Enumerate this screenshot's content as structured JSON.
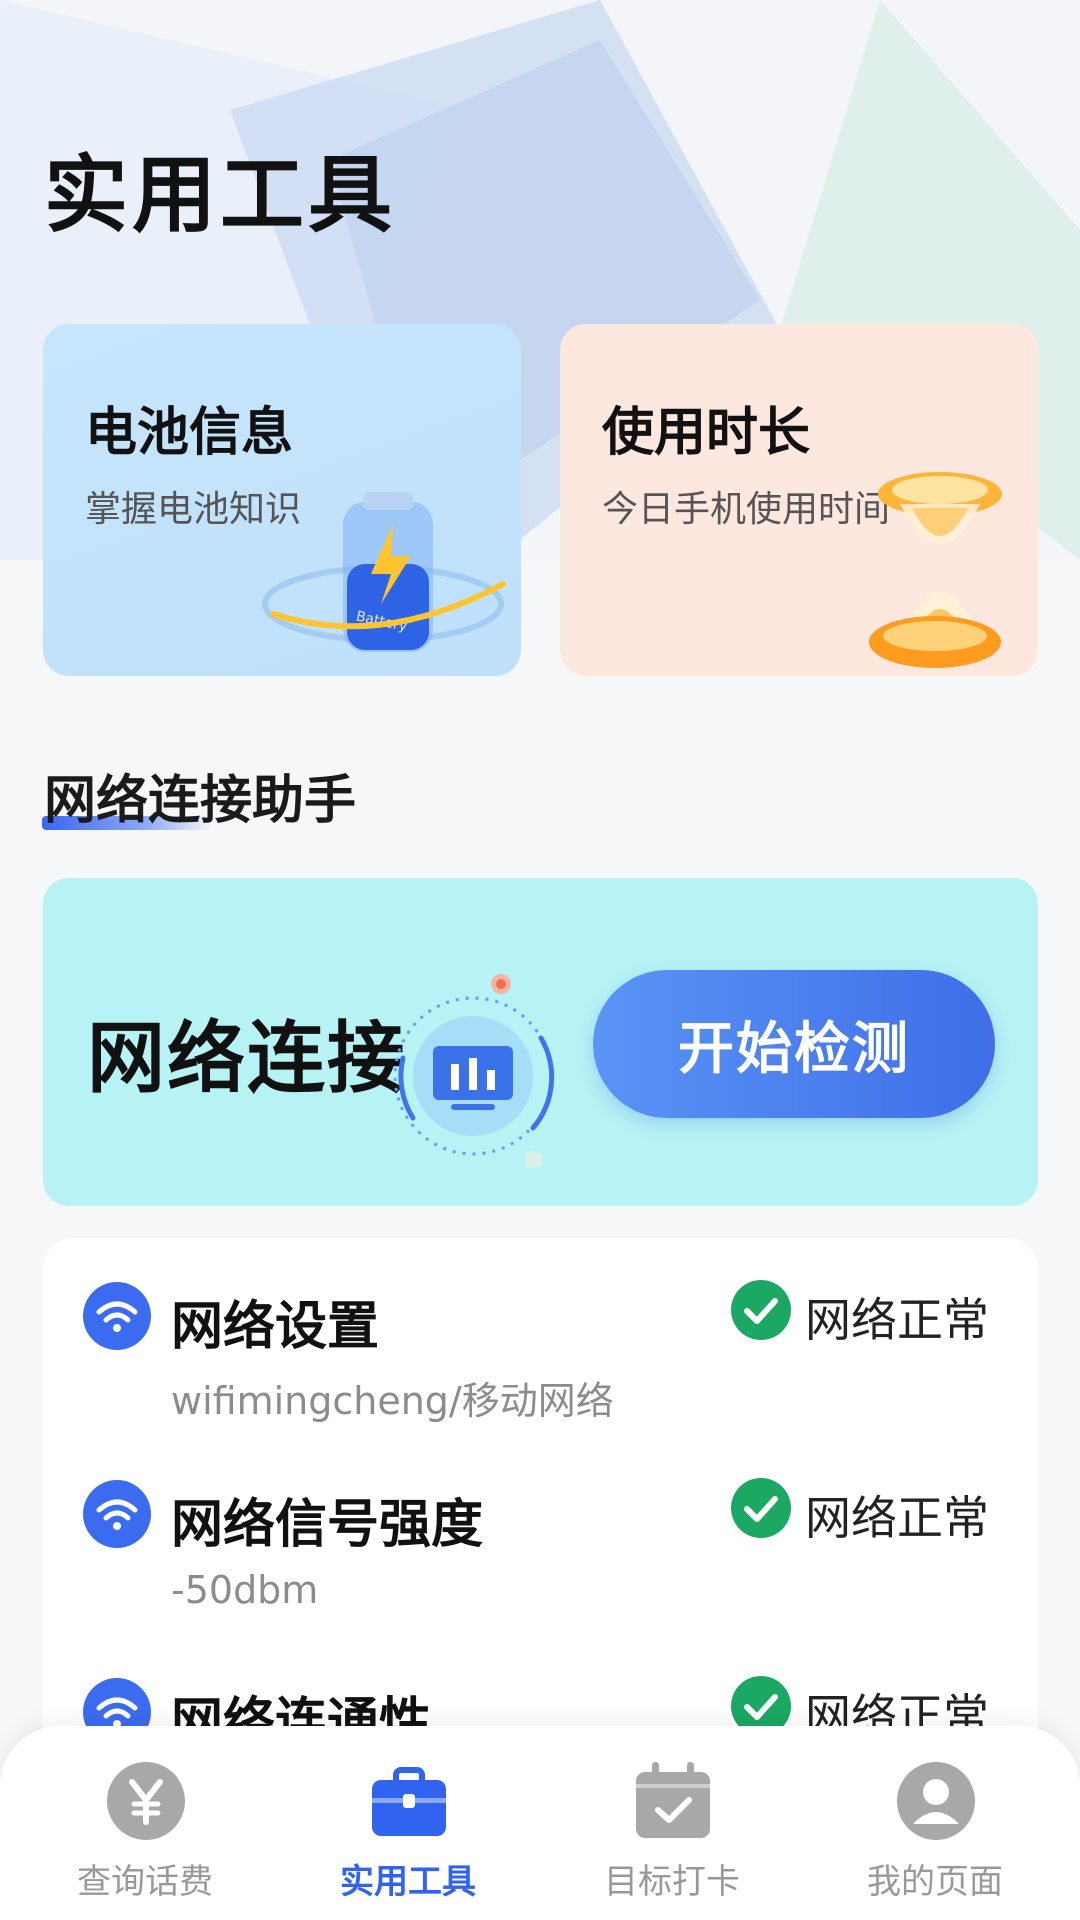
{
  "page": {
    "title": "实用工具"
  },
  "cards": {
    "battery": {
      "title": "电池信息",
      "subtitle": "掌握电池知识",
      "illus_text": "Battery"
    },
    "usage": {
      "title": "使用时长",
      "subtitle": "今日手机使用时间"
    }
  },
  "section": {
    "title": "网络连接助手"
  },
  "network_banner": {
    "title": "网络连接",
    "button_label": "开始检测"
  },
  "status_rows": [
    {
      "title": "网络设置",
      "subtitle": "wifimingcheng/移动网络",
      "status": "网络正常",
      "icon": "wifi-icon",
      "status_icon": "check-circle-icon"
    },
    {
      "title": "网络信号强度",
      "subtitle": "-50dbm",
      "status": "网络正常",
      "icon": "wifi-icon",
      "status_icon": "check-circle-icon"
    },
    {
      "title": "网络连通性",
      "subtitle": "",
      "status": "网络正常",
      "icon": "wifi-icon",
      "status_icon": "check-circle-icon"
    }
  ],
  "tabbar": {
    "items": [
      {
        "label": "查询话费",
        "icon": "yuan-icon",
        "active": false
      },
      {
        "label": "实用工具",
        "icon": "toolbox-icon",
        "active": true
      },
      {
        "label": "目标打卡",
        "icon": "calendar-check-icon",
        "active": false
      },
      {
        "label": "我的页面",
        "icon": "user-icon",
        "active": false
      }
    ]
  },
  "colors": {
    "accent": "#2f63f0",
    "battery_card": "#c3e3fc",
    "usage_card": "#fde7df",
    "network_banner": "#b7f2f4",
    "success": "#1aa862",
    "tab_inactive": "#999999"
  }
}
